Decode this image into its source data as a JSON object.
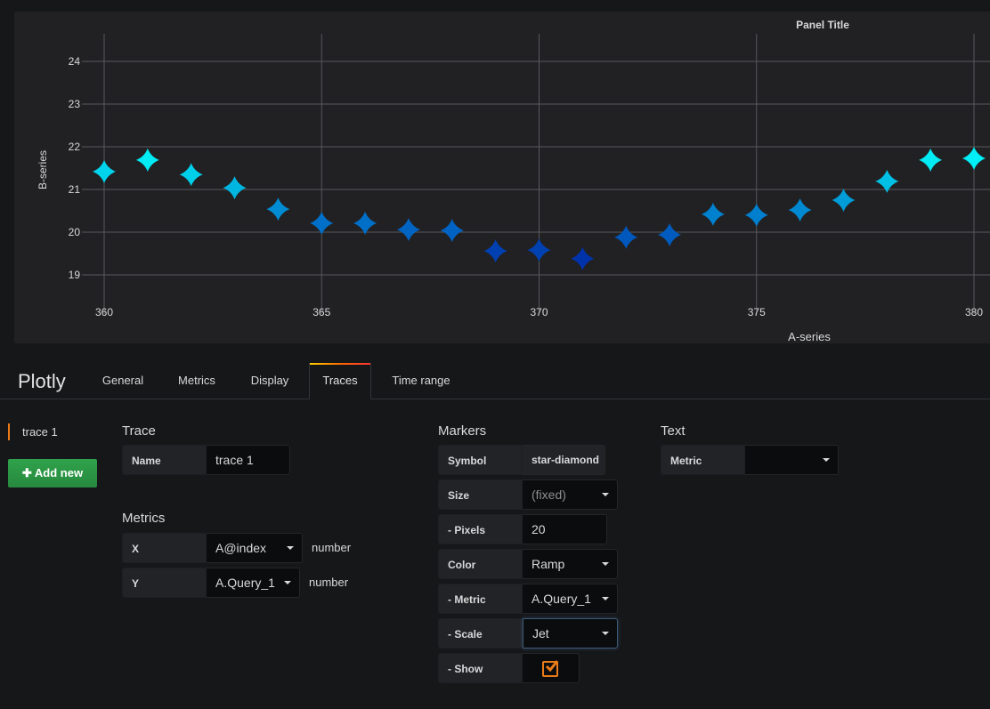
{
  "panel": {
    "title": "Panel Title"
  },
  "chart_data": {
    "type": "scatter",
    "title": "Panel Title",
    "xlabel": "A-series",
    "ylabel": "B-series",
    "xlim": [
      359.8,
      380.2
    ],
    "ylim": [
      18.4,
      24.6
    ],
    "xticks": [
      360,
      365,
      370,
      375,
      380
    ],
    "yticks": [
      19,
      20,
      21,
      22,
      23,
      24
    ],
    "grid": true,
    "marker": "star-diamond",
    "colorscale": "Jet",
    "x": [
      360,
      361,
      362,
      363,
      364,
      365,
      366,
      367,
      368,
      369,
      370,
      371,
      372,
      373,
      374,
      375,
      376,
      377,
      378,
      379,
      380
    ],
    "y": [
      21.42,
      21.69,
      21.35,
      21.04,
      20.54,
      20.21,
      20.21,
      20.06,
      20.04,
      19.56,
      19.58,
      19.38,
      19.88,
      19.94,
      20.42,
      20.4,
      20.52,
      20.75,
      21.19,
      21.69,
      21.73
    ]
  },
  "editor": {
    "title": "Plotly",
    "tabs": [
      {
        "label": "General",
        "active": false
      },
      {
        "label": "Metrics",
        "active": false
      },
      {
        "label": "Display",
        "active": false
      },
      {
        "label": "Traces",
        "active": true
      },
      {
        "label": "Time range",
        "active": false
      }
    ]
  },
  "traces": {
    "items": [
      "trace 1"
    ],
    "add_label": "Add new"
  },
  "trace_section": {
    "title": "Trace",
    "name_label": "Name",
    "name_value": "trace 1"
  },
  "metrics_section": {
    "title": "Metrics",
    "x_label": "X",
    "x_value": "A@index",
    "x_type": "number",
    "y_label": "Y",
    "y_value": "A.Query_1",
    "y_type": "number"
  },
  "markers_section": {
    "title": "Markers",
    "symbol_label": "Symbol",
    "symbol_value": "star-diamond",
    "size_label": "Size",
    "size_value": "(fixed)",
    "pixels_label": "- Pixels",
    "pixels_value": "20",
    "color_label": "Color",
    "color_value": "Ramp",
    "metric_label": "- Metric",
    "metric_value": "A.Query_1",
    "scale_label": "- Scale",
    "scale_value": "Jet",
    "show_label": "- Show",
    "show_checked": true
  },
  "text_section": {
    "title": "Text",
    "metric_label": "Metric",
    "metric_value": ""
  }
}
